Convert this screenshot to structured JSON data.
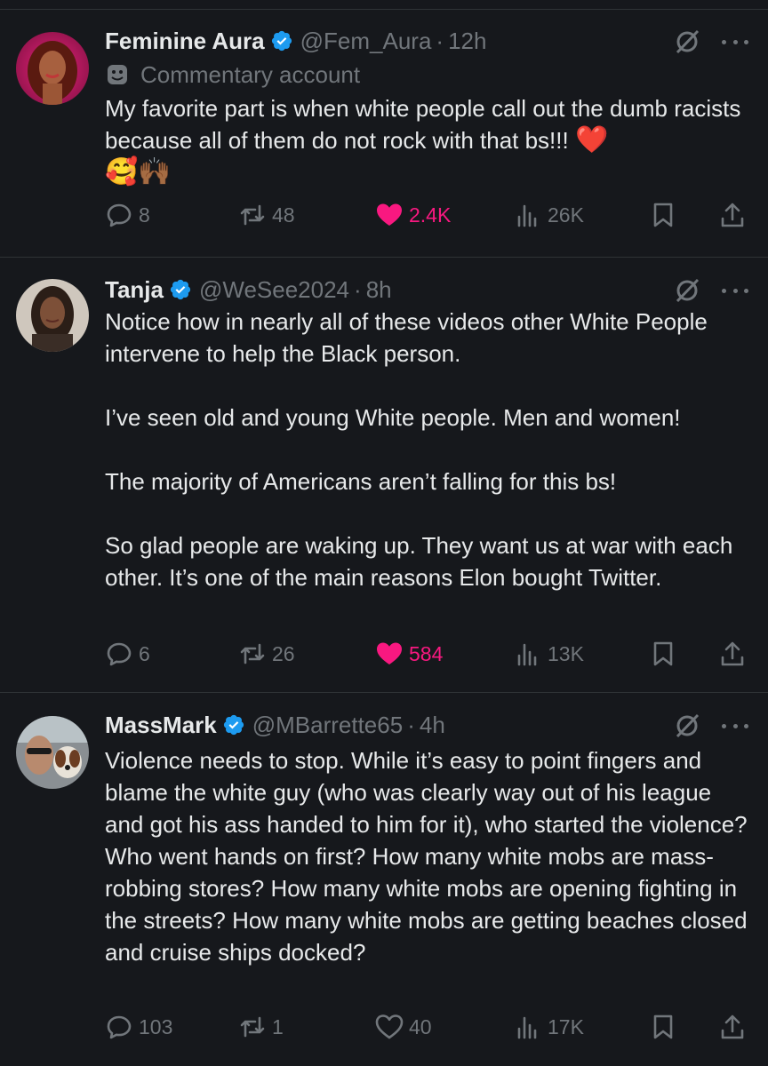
{
  "tweets": [
    {
      "name": "Feminine Aura",
      "handle": "@Fem_Aura",
      "sep": "·",
      "time": "12h",
      "label": "Commentary account",
      "text": "My favorite part is when white people call out the dumb racists because all of them do not rock with that bs!!! ",
      "emoji_line": "🥰🙌🏾",
      "heart_emoji": "❤️",
      "replies": "8",
      "reposts": "48",
      "likes": "2.4K",
      "views": "26K",
      "liked": true
    },
    {
      "name": "Tanja",
      "handle": "@WeSee2024",
      "sep": "·",
      "time": "8h",
      "text": "Notice how in nearly all of these videos other White People intervene to help the Black person.\n\nI’ve seen old and young White people. Men and women!\n\nThe majority of Americans aren’t falling for this bs!\n\nSo glad people are waking up. They want us at war with each other. It’s one of the main reasons Elon bought Twitter.",
      "replies": "6",
      "reposts": "26",
      "likes": "584",
      "views": "13K",
      "liked": true
    },
    {
      "name": "MassMark",
      "handle": "@MBarrette65",
      "sep": "·",
      "time": "4h",
      "text": "Violence needs to stop. While it’s easy to point fingers and blame the white guy (who was clearly way out of his league and got his ass handed to him for it), who started the violence? Who went hands on first? How many white mobs are mass-robbing stores? How many white mobs are opening fighting in the streets? How many white mobs are getting beaches closed and cruise ships docked?",
      "replies": "103",
      "reposts": "1",
      "likes": "40",
      "views": "17K",
      "liked": false
    }
  ],
  "colors": {
    "background": "#16181c",
    "text": "#e7e9ea",
    "muted": "#71767b",
    "like": "#f91880",
    "verified": "#1d9bf0",
    "divider": "#2f3336"
  },
  "icons": [
    "verified-badge-icon",
    "grok-icon",
    "more-icon",
    "reply-icon",
    "repost-icon",
    "like-icon",
    "views-icon",
    "bookmark-icon",
    "share-icon",
    "commentary-label-icon"
  ]
}
